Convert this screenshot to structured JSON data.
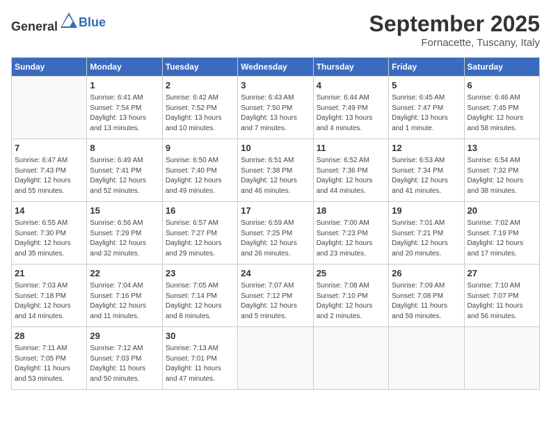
{
  "header": {
    "logo_general": "General",
    "logo_blue": "Blue",
    "month": "September 2025",
    "location": "Fornacette, Tuscany, Italy"
  },
  "weekdays": [
    "Sunday",
    "Monday",
    "Tuesday",
    "Wednesday",
    "Thursday",
    "Friday",
    "Saturday"
  ],
  "weeks": [
    [
      {
        "day": "",
        "info": ""
      },
      {
        "day": "1",
        "info": "Sunrise: 6:41 AM\nSunset: 7:54 PM\nDaylight: 13 hours\nand 13 minutes."
      },
      {
        "day": "2",
        "info": "Sunrise: 6:42 AM\nSunset: 7:52 PM\nDaylight: 13 hours\nand 10 minutes."
      },
      {
        "day": "3",
        "info": "Sunrise: 6:43 AM\nSunset: 7:50 PM\nDaylight: 13 hours\nand 7 minutes."
      },
      {
        "day": "4",
        "info": "Sunrise: 6:44 AM\nSunset: 7:49 PM\nDaylight: 13 hours\nand 4 minutes."
      },
      {
        "day": "5",
        "info": "Sunrise: 6:45 AM\nSunset: 7:47 PM\nDaylight: 13 hours\nand 1 minute."
      },
      {
        "day": "6",
        "info": "Sunrise: 6:46 AM\nSunset: 7:45 PM\nDaylight: 12 hours\nand 58 minutes."
      }
    ],
    [
      {
        "day": "7",
        "info": "Sunrise: 6:47 AM\nSunset: 7:43 PM\nDaylight: 12 hours\nand 55 minutes."
      },
      {
        "day": "8",
        "info": "Sunrise: 6:49 AM\nSunset: 7:41 PM\nDaylight: 12 hours\nand 52 minutes."
      },
      {
        "day": "9",
        "info": "Sunrise: 6:50 AM\nSunset: 7:40 PM\nDaylight: 12 hours\nand 49 minutes."
      },
      {
        "day": "10",
        "info": "Sunrise: 6:51 AM\nSunset: 7:38 PM\nDaylight: 12 hours\nand 46 minutes."
      },
      {
        "day": "11",
        "info": "Sunrise: 6:52 AM\nSunset: 7:36 PM\nDaylight: 12 hours\nand 44 minutes."
      },
      {
        "day": "12",
        "info": "Sunrise: 6:53 AM\nSunset: 7:34 PM\nDaylight: 12 hours\nand 41 minutes."
      },
      {
        "day": "13",
        "info": "Sunrise: 6:54 AM\nSunset: 7:32 PM\nDaylight: 12 hours\nand 38 minutes."
      }
    ],
    [
      {
        "day": "14",
        "info": "Sunrise: 6:55 AM\nSunset: 7:30 PM\nDaylight: 12 hours\nand 35 minutes."
      },
      {
        "day": "15",
        "info": "Sunrise: 6:56 AM\nSunset: 7:29 PM\nDaylight: 12 hours\nand 32 minutes."
      },
      {
        "day": "16",
        "info": "Sunrise: 6:57 AM\nSunset: 7:27 PM\nDaylight: 12 hours\nand 29 minutes."
      },
      {
        "day": "17",
        "info": "Sunrise: 6:59 AM\nSunset: 7:25 PM\nDaylight: 12 hours\nand 26 minutes."
      },
      {
        "day": "18",
        "info": "Sunrise: 7:00 AM\nSunset: 7:23 PM\nDaylight: 12 hours\nand 23 minutes."
      },
      {
        "day": "19",
        "info": "Sunrise: 7:01 AM\nSunset: 7:21 PM\nDaylight: 12 hours\nand 20 minutes."
      },
      {
        "day": "20",
        "info": "Sunrise: 7:02 AM\nSunset: 7:19 PM\nDaylight: 12 hours\nand 17 minutes."
      }
    ],
    [
      {
        "day": "21",
        "info": "Sunrise: 7:03 AM\nSunset: 7:18 PM\nDaylight: 12 hours\nand 14 minutes."
      },
      {
        "day": "22",
        "info": "Sunrise: 7:04 AM\nSunset: 7:16 PM\nDaylight: 12 hours\nand 11 minutes."
      },
      {
        "day": "23",
        "info": "Sunrise: 7:05 AM\nSunset: 7:14 PM\nDaylight: 12 hours\nand 8 minutes."
      },
      {
        "day": "24",
        "info": "Sunrise: 7:07 AM\nSunset: 7:12 PM\nDaylight: 12 hours\nand 5 minutes."
      },
      {
        "day": "25",
        "info": "Sunrise: 7:08 AM\nSunset: 7:10 PM\nDaylight: 12 hours\nand 2 minutes."
      },
      {
        "day": "26",
        "info": "Sunrise: 7:09 AM\nSunset: 7:08 PM\nDaylight: 11 hours\nand 59 minutes."
      },
      {
        "day": "27",
        "info": "Sunrise: 7:10 AM\nSunset: 7:07 PM\nDaylight: 11 hours\nand 56 minutes."
      }
    ],
    [
      {
        "day": "28",
        "info": "Sunrise: 7:11 AM\nSunset: 7:05 PM\nDaylight: 11 hours\nand 53 minutes."
      },
      {
        "day": "29",
        "info": "Sunrise: 7:12 AM\nSunset: 7:03 PM\nDaylight: 11 hours\nand 50 minutes."
      },
      {
        "day": "30",
        "info": "Sunrise: 7:13 AM\nSunset: 7:01 PM\nDaylight: 11 hours\nand 47 minutes."
      },
      {
        "day": "",
        "info": ""
      },
      {
        "day": "",
        "info": ""
      },
      {
        "day": "",
        "info": ""
      },
      {
        "day": "",
        "info": ""
      }
    ]
  ]
}
